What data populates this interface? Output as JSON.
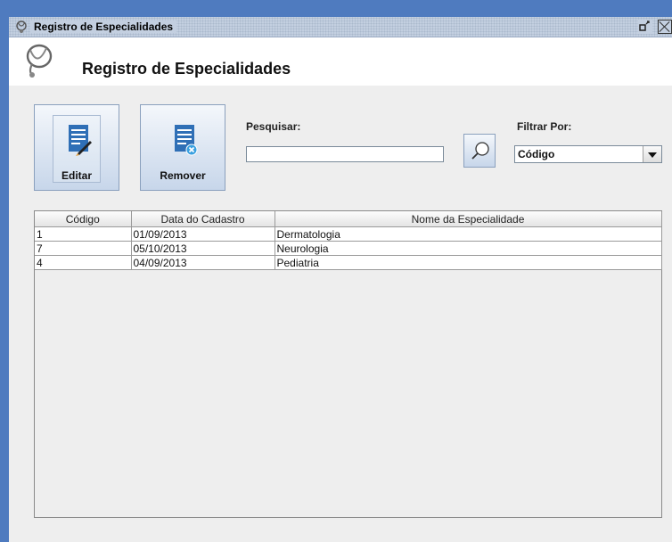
{
  "window": {
    "title": "Registro de Especialidades",
    "minimize_glyph": "ᵔ"
  },
  "header": {
    "title": "Registro de Especialidades",
    "logo_icon": "stethoscope-icon"
  },
  "toolbar": {
    "edit_label": "Editar",
    "remove_label": "Remover",
    "edit_icon": "edit-document-icon",
    "remove_icon": "remove-document-icon"
  },
  "search": {
    "label": "Pesquisar:",
    "value": "",
    "button_icon": "search-icon"
  },
  "filter": {
    "label": "Filtrar Por:",
    "selected": "Código"
  },
  "table": {
    "columns": [
      "Código",
      "Data do Cadastro",
      "Nome da Especialidade"
    ],
    "rows": [
      [
        "1",
        "01/09/2013",
        "Dermatologia"
      ],
      [
        "7",
        "05/10/2013",
        "Neurologia"
      ],
      [
        "4",
        "04/09/2013",
        "Pediatria"
      ]
    ]
  },
  "colors": {
    "window_border": "#4f7bbf",
    "titlebar": "#c3cfe0",
    "button_gradient_top": "#f4f7fb",
    "button_gradient_bottom": "#c7d6ea",
    "icon_blue": "#2f6fb6"
  }
}
